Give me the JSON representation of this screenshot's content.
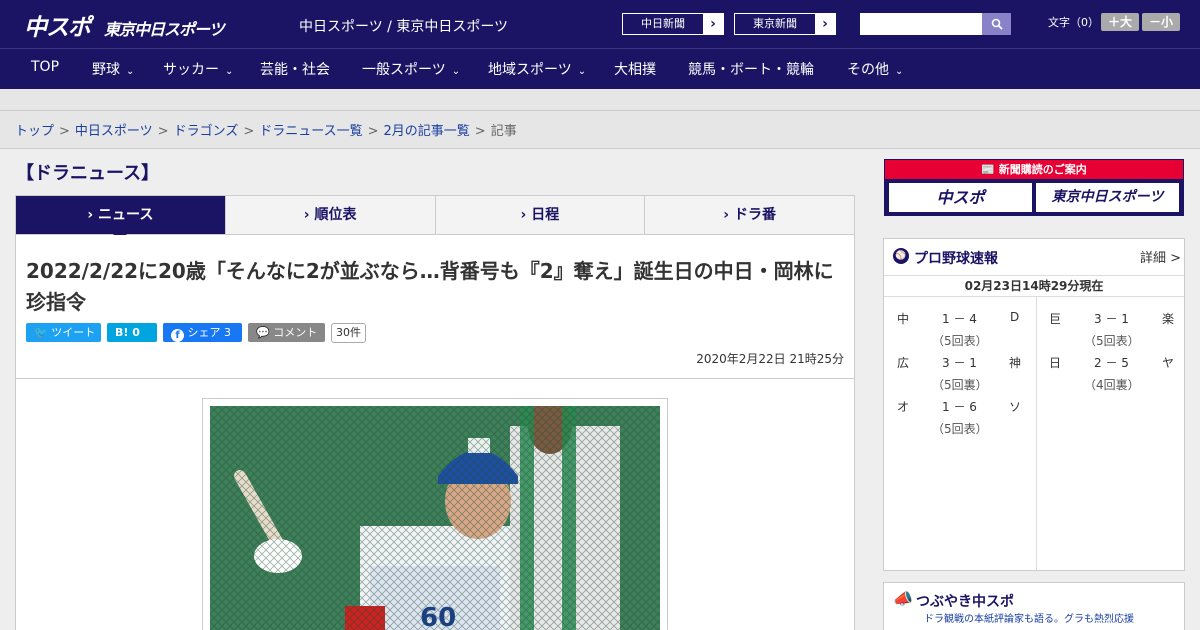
{
  "header": {
    "logo_main": "中スポ",
    "logo_sub": "東京中日スポーツ",
    "site_name": "中日スポーツ / 東京中日スポーツ",
    "link_chunichi": "中日新聞",
    "link_tokyo": "東京新聞",
    "link_arrow": "›",
    "search_icon": "search-icon",
    "font_size_label": "文字（0）",
    "font_larger": "＋大",
    "font_smaller": "－小"
  },
  "nav": {
    "items": [
      {
        "label": "TOP",
        "has_menu": false
      },
      {
        "label": "野球",
        "has_menu": true
      },
      {
        "label": "サッカー",
        "has_menu": true
      },
      {
        "label": "芸能・社会",
        "has_menu": false
      },
      {
        "label": "一般スポーツ",
        "has_menu": true
      },
      {
        "label": "地域スポーツ",
        "has_menu": true
      },
      {
        "label": "大相撲",
        "has_menu": false
      },
      {
        "label": "競馬・ボート・競輪",
        "has_menu": false
      },
      {
        "label": "その他",
        "has_menu": true
      }
    ],
    "chevron": "⌄"
  },
  "breadcrumb": {
    "items": [
      "トップ",
      "中日スポーツ",
      "ドラゴンズ",
      "ドラニュース一覧",
      "2月の記事一覧"
    ],
    "current": "記事",
    "separator": ">"
  },
  "section": {
    "title": "【ドラニュース】",
    "tabs": [
      {
        "label": "› ニュース",
        "active": true
      },
      {
        "label": "› 順位表",
        "active": false
      },
      {
        "label": "› 日程",
        "active": false
      },
      {
        "label": "› ドラ番",
        "active": false
      }
    ]
  },
  "article": {
    "headline": "2022/2/22に20歳「そんなに2が並ぶなら…背番号も『2』奪え」誕生日の中日・岡林に珍指令",
    "share": {
      "tweet": "ツイート",
      "hatena": "B! 0",
      "facebook": "シェア 3",
      "comment": "コメント",
      "comment_count": "30件"
    },
    "date": "2020年2月22日 21時25分",
    "photo_jersey": "60"
  },
  "sidebar": {
    "subscribe": {
      "title": "新聞購読のご案内",
      "btn_chuspo": "中スポ",
      "btn_tokyo": "東京中日スポーツ"
    },
    "scores": {
      "title": "プロ野球速報",
      "more": "詳細 >",
      "updated": "02月23日14時29分現在",
      "games": [
        {
          "home": "中",
          "score": "1 － 4",
          "away": "D",
          "status": "（5回表）"
        },
        {
          "home": "巨",
          "score": "3 － 1",
          "away": "楽",
          "status": "（5回表）"
        },
        {
          "home": "広",
          "score": "3 － 1",
          "away": "神",
          "status": "（5回裏）"
        },
        {
          "home": "日",
          "score": "2 － 5",
          "away": "ヤ",
          "status": "（4回裏）"
        },
        {
          "home": "オ",
          "score": "1 － 6",
          "away": "ソ",
          "status": "（5回表）"
        }
      ]
    },
    "tweets": {
      "title": "つぶやき中スポ",
      "subtitle": "ドラ観戦の本紙評論家も語る。グラも熱烈応援"
    }
  },
  "colors": {
    "brand_navy": "#1b1464",
    "subscribe_red": "#e60033",
    "twitter": "#1da1f2",
    "hatena": "#00a4de",
    "facebook": "#1877f2",
    "comment": "#888888"
  }
}
